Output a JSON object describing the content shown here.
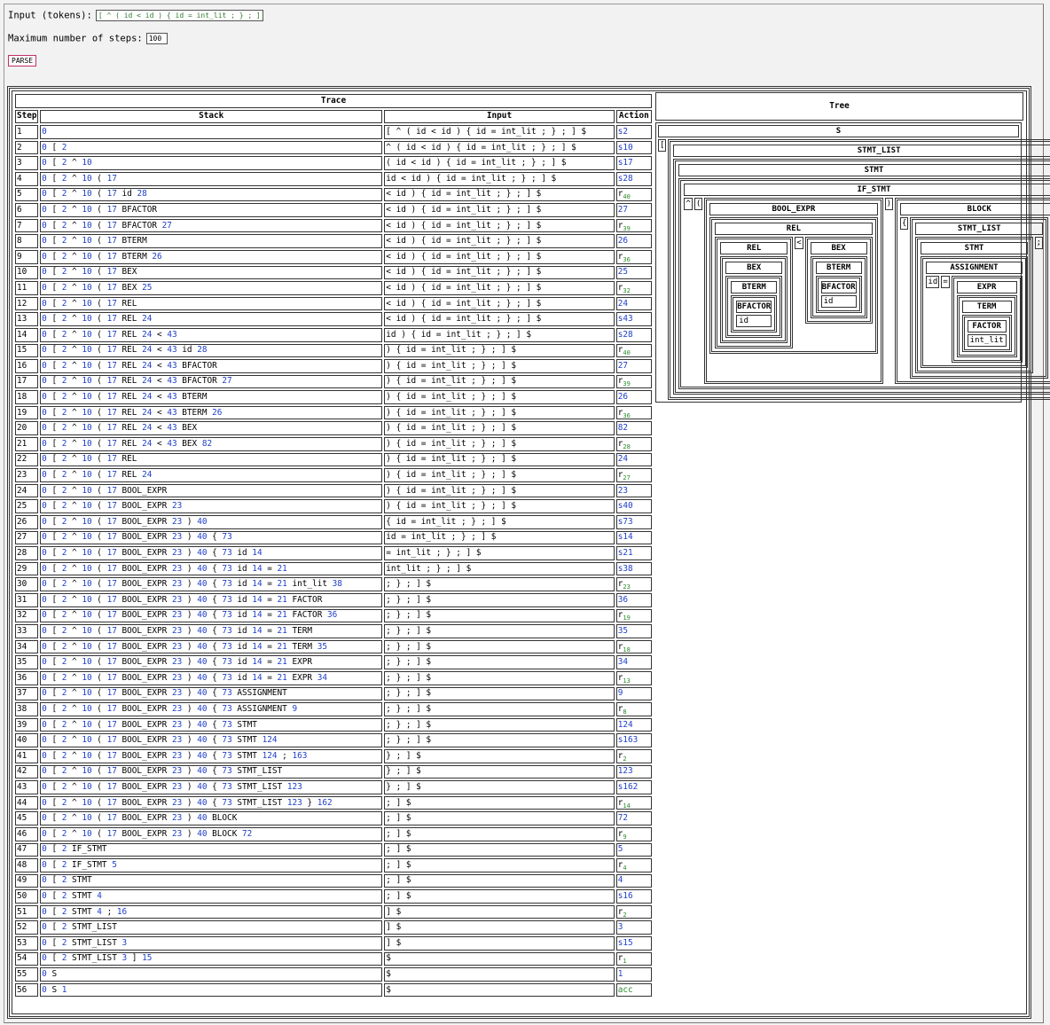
{
  "controls": {
    "input_label": "Input (tokens):",
    "input_value": "[ ^ ( id < id ) { id = int_lit ; } ; ]",
    "steps_label": "Maximum number of steps:",
    "steps_value": "100",
    "parse_label": "PARSE"
  },
  "trace": {
    "title": "Trace",
    "headers": [
      "Step",
      "Stack",
      "Input",
      "Action"
    ],
    "rows": [
      {
        "step": "1",
        "stack": "0",
        "input": "[ ^ ( id < id ) { id = int_lit ; } ; ] $",
        "action": "s2"
      },
      {
        "step": "2",
        "stack": "0 [ 2",
        "input": "^ ( id < id ) { id = int_lit ; } ; ] $",
        "action": "s10"
      },
      {
        "step": "3",
        "stack": "0 [ 2 ^ 10",
        "input": "( id < id ) { id = int_lit ; } ; ] $",
        "action": "s17"
      },
      {
        "step": "4",
        "stack": "0 [ 2 ^ 10 ( 17",
        "input": "id < id ) { id = int_lit ; } ; ] $",
        "action": "s28"
      },
      {
        "step": "5",
        "stack": "0 [ 2 ^ 10 ( 17 id 28",
        "input": "< id ) { id = int_lit ; } ; ] $",
        "action": "r40"
      },
      {
        "step": "6",
        "stack": "0 [ 2 ^ 10 ( 17 BFACTOR",
        "input": "< id ) { id = int_lit ; } ; ] $",
        "action": "27"
      },
      {
        "step": "7",
        "stack": "0 [ 2 ^ 10 ( 17 BFACTOR 27",
        "input": "< id ) { id = int_lit ; } ; ] $",
        "action": "r39"
      },
      {
        "step": "8",
        "stack": "0 [ 2 ^ 10 ( 17 BTERM",
        "input": "< id ) { id = int_lit ; } ; ] $",
        "action": "26"
      },
      {
        "step": "9",
        "stack": "0 [ 2 ^ 10 ( 17 BTERM 26",
        "input": "< id ) { id = int_lit ; } ; ] $",
        "action": "r36"
      },
      {
        "step": "10",
        "stack": "0 [ 2 ^ 10 ( 17 BEX",
        "input": "< id ) { id = int_lit ; } ; ] $",
        "action": "25"
      },
      {
        "step": "11",
        "stack": "0 [ 2 ^ 10 ( 17 BEX 25",
        "input": "< id ) { id = int_lit ; } ; ] $",
        "action": "r32"
      },
      {
        "step": "12",
        "stack": "0 [ 2 ^ 10 ( 17 REL",
        "input": "< id ) { id = int_lit ; } ; ] $",
        "action": "24"
      },
      {
        "step": "13",
        "stack": "0 [ 2 ^ 10 ( 17 REL 24",
        "input": "< id ) { id = int_lit ; } ; ] $",
        "action": "s43"
      },
      {
        "step": "14",
        "stack": "0 [ 2 ^ 10 ( 17 REL 24 < 43",
        "input": "id ) { id = int_lit ; } ; ] $",
        "action": "s28"
      },
      {
        "step": "15",
        "stack": "0 [ 2 ^ 10 ( 17 REL 24 < 43 id 28",
        "input": ") { id = int_lit ; } ; ] $",
        "action": "r40"
      },
      {
        "step": "16",
        "stack": "0 [ 2 ^ 10 ( 17 REL 24 < 43 BFACTOR",
        "input": ") { id = int_lit ; } ; ] $",
        "action": "27"
      },
      {
        "step": "17",
        "stack": "0 [ 2 ^ 10 ( 17 REL 24 < 43 BFACTOR 27",
        "input": ") { id = int_lit ; } ; ] $",
        "action": "r39"
      },
      {
        "step": "18",
        "stack": "0 [ 2 ^ 10 ( 17 REL 24 < 43 BTERM",
        "input": ") { id = int_lit ; } ; ] $",
        "action": "26"
      },
      {
        "step": "19",
        "stack": "0 [ 2 ^ 10 ( 17 REL 24 < 43 BTERM 26",
        "input": ") { id = int_lit ; } ; ] $",
        "action": "r36"
      },
      {
        "step": "20",
        "stack": "0 [ 2 ^ 10 ( 17 REL 24 < 43 BEX",
        "input": ") { id = int_lit ; } ; ] $",
        "action": "82"
      },
      {
        "step": "21",
        "stack": "0 [ 2 ^ 10 ( 17 REL 24 < 43 BEX 82",
        "input": ") { id = int_lit ; } ; ] $",
        "action": "r28"
      },
      {
        "step": "22",
        "stack": "0 [ 2 ^ 10 ( 17 REL",
        "input": ") { id = int_lit ; } ; ] $",
        "action": "24"
      },
      {
        "step": "23",
        "stack": "0 [ 2 ^ 10 ( 17 REL 24",
        "input": ") { id = int_lit ; } ; ] $",
        "action": "r27"
      },
      {
        "step": "24",
        "stack": "0 [ 2 ^ 10 ( 17 BOOL_EXPR",
        "input": ") { id = int_lit ; } ; ] $",
        "action": "23"
      },
      {
        "step": "25",
        "stack": "0 [ 2 ^ 10 ( 17 BOOL_EXPR 23",
        "input": ") { id = int_lit ; } ; ] $",
        "action": "s40"
      },
      {
        "step": "26",
        "stack": "0 [ 2 ^ 10 ( 17 BOOL_EXPR 23 ) 40",
        "input": "{ id = int_lit ; } ; ] $",
        "action": "s73"
      },
      {
        "step": "27",
        "stack": "0 [ 2 ^ 10 ( 17 BOOL_EXPR 23 ) 40 { 73",
        "input": "id = int_lit ; } ; ] $",
        "action": "s14"
      },
      {
        "step": "28",
        "stack": "0 [ 2 ^ 10 ( 17 BOOL_EXPR 23 ) 40 { 73 id 14",
        "input": "= int_lit ; } ; ] $",
        "action": "s21"
      },
      {
        "step": "29",
        "stack": "0 [ 2 ^ 10 ( 17 BOOL_EXPR 23 ) 40 { 73 id 14 = 21",
        "input": "int_lit ; } ; ] $",
        "action": "s38"
      },
      {
        "step": "30",
        "stack": "0 [ 2 ^ 10 ( 17 BOOL_EXPR 23 ) 40 { 73 id 14 = 21 int_lit 38",
        "input": "; } ; ] $",
        "action": "r23"
      },
      {
        "step": "31",
        "stack": "0 [ 2 ^ 10 ( 17 BOOL_EXPR 23 ) 40 { 73 id 14 = 21 FACTOR",
        "input": "; } ; ] $",
        "action": "36"
      },
      {
        "step": "32",
        "stack": "0 [ 2 ^ 10 ( 17 BOOL_EXPR 23 ) 40 { 73 id 14 = 21 FACTOR 36",
        "input": "; } ; ] $",
        "action": "r19"
      },
      {
        "step": "33",
        "stack": "0 [ 2 ^ 10 ( 17 BOOL_EXPR 23 ) 40 { 73 id 14 = 21 TERM",
        "input": "; } ; ] $",
        "action": "35"
      },
      {
        "step": "34",
        "stack": "0 [ 2 ^ 10 ( 17 BOOL_EXPR 23 ) 40 { 73 id 14 = 21 TERM 35",
        "input": "; } ; ] $",
        "action": "r18"
      },
      {
        "step": "35",
        "stack": "0 [ 2 ^ 10 ( 17 BOOL_EXPR 23 ) 40 { 73 id 14 = 21 EXPR",
        "input": "; } ; ] $",
        "action": "34"
      },
      {
        "step": "36",
        "stack": "0 [ 2 ^ 10 ( 17 BOOL_EXPR 23 ) 40 { 73 id 14 = 21 EXPR 34",
        "input": "; } ; ] $",
        "action": "r13"
      },
      {
        "step": "37",
        "stack": "0 [ 2 ^ 10 ( 17 BOOL_EXPR 23 ) 40 { 73 ASSIGNMENT",
        "input": "; } ; ] $",
        "action": "9"
      },
      {
        "step": "38",
        "stack": "0 [ 2 ^ 10 ( 17 BOOL_EXPR 23 ) 40 { 73 ASSIGNMENT 9",
        "input": "; } ; ] $",
        "action": "r8"
      },
      {
        "step": "39",
        "stack": "0 [ 2 ^ 10 ( 17 BOOL_EXPR 23 ) 40 { 73 STMT",
        "input": "; } ; ] $",
        "action": "124"
      },
      {
        "step": "40",
        "stack": "0 [ 2 ^ 10 ( 17 BOOL_EXPR 23 ) 40 { 73 STMT 124",
        "input": "; } ; ] $",
        "action": "s163"
      },
      {
        "step": "41",
        "stack": "0 [ 2 ^ 10 ( 17 BOOL_EXPR 23 ) 40 { 73 STMT 124 ; 163",
        "input": "} ; ] $",
        "action": "r2"
      },
      {
        "step": "42",
        "stack": "0 [ 2 ^ 10 ( 17 BOOL_EXPR 23 ) 40 { 73 STMT_LIST",
        "input": "} ; ] $",
        "action": "123"
      },
      {
        "step": "43",
        "stack": "0 [ 2 ^ 10 ( 17 BOOL_EXPR 23 ) 40 { 73 STMT_LIST 123",
        "input": "} ; ] $",
        "action": "s162"
      },
      {
        "step": "44",
        "stack": "0 [ 2 ^ 10 ( 17 BOOL_EXPR 23 ) 40 { 73 STMT_LIST 123 } 162",
        "input": "; ] $",
        "action": "r14"
      },
      {
        "step": "45",
        "stack": "0 [ 2 ^ 10 ( 17 BOOL_EXPR 23 ) 40 BLOCK",
        "input": "; ] $",
        "action": "72"
      },
      {
        "step": "46",
        "stack": "0 [ 2 ^ 10 ( 17 BOOL_EXPR 23 ) 40 BLOCK 72",
        "input": "; ] $",
        "action": "r9"
      },
      {
        "step": "47",
        "stack": "0 [ 2 IF_STMT",
        "input": "; ] $",
        "action": "5"
      },
      {
        "step": "48",
        "stack": "0 [ 2 IF_STMT 5",
        "input": "; ] $",
        "action": "r4"
      },
      {
        "step": "49",
        "stack": "0 [ 2 STMT",
        "input": "; ] $",
        "action": "4"
      },
      {
        "step": "50",
        "stack": "0 [ 2 STMT 4",
        "input": "; ] $",
        "action": "s16"
      },
      {
        "step": "51",
        "stack": "0 [ 2 STMT 4 ; 16",
        "input": "] $",
        "action": "r2"
      },
      {
        "step": "52",
        "stack": "0 [ 2 STMT_LIST",
        "input": "] $",
        "action": "3"
      },
      {
        "step": "53",
        "stack": "0 [ 2 STMT_LIST 3",
        "input": "] $",
        "action": "s15"
      },
      {
        "step": "54",
        "stack": "0 [ 2 STMT_LIST 3 ] 15",
        "input": "$",
        "action": "r1"
      },
      {
        "step": "55",
        "stack": "0 S",
        "input": "$",
        "action": "1"
      },
      {
        "step": "56",
        "stack": "0 S 1",
        "input": "$",
        "action": "acc"
      }
    ]
  },
  "tree": {
    "title": "Tree",
    "labels": {
      "s": "S",
      "stmt_list": "STMT_LIST",
      "stmt": "STMT",
      "if_stmt": "IF_STMT",
      "bool_expr": "BOOL_EXPR",
      "rel": "REL",
      "rel_inner": "REL",
      "bex_left": "BEX",
      "bterm_left": "BTERM",
      "bfactor_left": "BFACTOR",
      "bex_right": "BEX",
      "bterm_right": "BTERM",
      "bfactor_right": "BFACTOR",
      "block": "BLOCK",
      "block_stmt_list": "STMT_LIST",
      "block_stmt": "STMT",
      "assignment": "ASSIGNMENT",
      "expr": "EXPR",
      "term": "TERM",
      "factor": "FACTOR"
    },
    "terminals": {
      "lbracket": "[",
      "rbracket": "]",
      "semi_outer": ";",
      "caret": "^",
      "lparen": "(",
      "rparen": ")",
      "lt": "<",
      "id_left": "id",
      "id_right": "id",
      "lbrace": "{",
      "rbrace": "}",
      "semi_inner": ";",
      "id_assign": "id",
      "eq": "=",
      "int_lit": "int_lit"
    }
  }
}
